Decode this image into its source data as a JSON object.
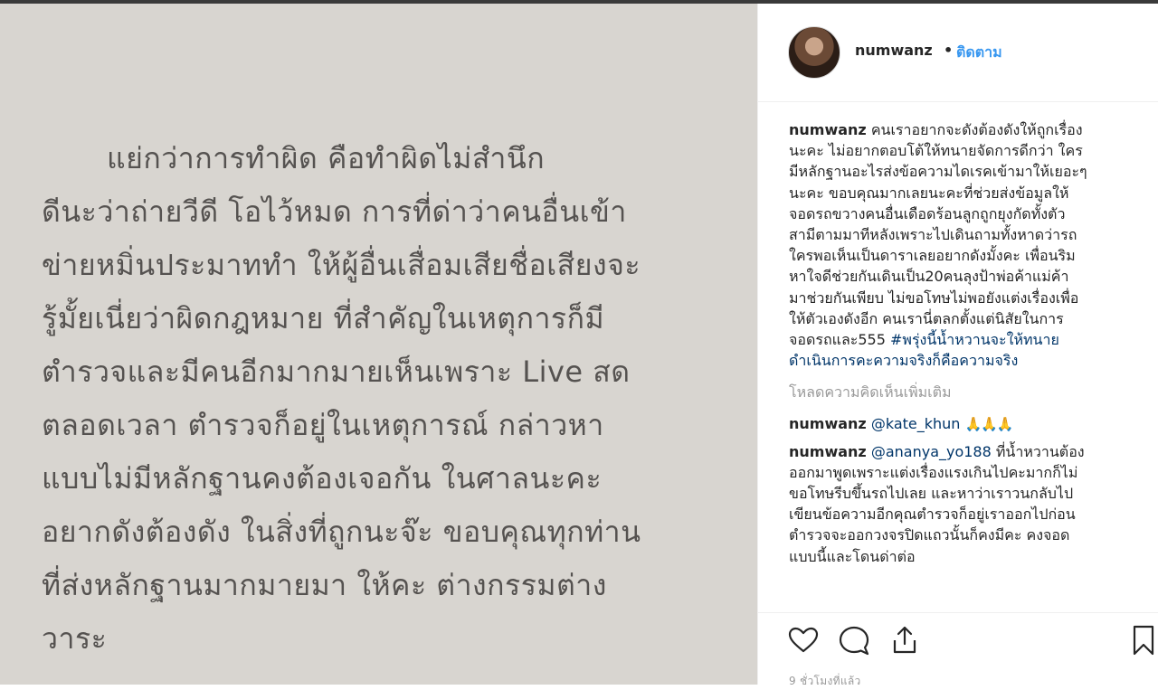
{
  "media": {
    "lines": [
      "แย่กว่าการทำผิด คือทำผิดไม่สำนึก",
      "ดีนะว่าถ่ายวีดี โอไว้หมด การที่ด่าว่าคนอื่นเข้า",
      "ข่ายหมิ่นประมาททำ ให้ผู้อื่นเสื่อมเสียชื่อเสียงจะ",
      "รู้มั้ยเนี่ยว่าผิดกฎหมาย ที่สำคัญในเหตุการก็มี",
      "ตำรวจและมีคนอีกมากมายเห็นเพราะ Live สด",
      "ตลอดเวลา ตำรวจก็อยู่ในเหตุการณ์ กล่าวหา",
      "แบบไม่มีหลักฐานคงต้องเจอกัน ในศาลนะคะ",
      "อยากดังต้องดัง ในสิ่งที่ถูกนะจ๊ะ ขอบคุณทุกท่าน",
      "ที่ส่งหลักฐานมากมายมา ให้คะ ต่างกรรมต่าง",
      "วาระ"
    ]
  },
  "header": {
    "username": "numwanz",
    "separator": "•",
    "follow_label": "ติดตาม"
  },
  "caption": {
    "username": "numwanz",
    "lines": [
      " คนเราอยากจะดังต้องดังให้ถูกเรื่อง",
      "นะคะ ไม่อยากตอบโต้ให้ทนายจัดการดีกว่า ใคร",
      "มีหลักฐานอะไรส่งข้อความไดเรคเข้ามาให้เยอะๆ",
      "นะคะ ขอบคุณมากเลยนะคะที่ช่วยส่งข้อมูลให้",
      "จอดรถขวางคนอื่นเดือดร้อนลูกถูกยุงกัดทั้งตัว",
      "สามีตามมาทีหลังเพราะไปเดินถามทั้งหาดว่ารถ",
      "ใครพอเห็นเป็นดาราเลยอยากดังมั้งคะ เพื่อนริม",
      "หาใจดีช่วยกันเดินเป็น20คนลุงป้าพ่อค้าแม่ค้า",
      "มาช่วยกันเพียบ ไม่ขอโทษไม่พอยังแต่งเรื่องเพื่อ",
      "ให้ตัวเองดังอีก คนเรานี่ตลกตั้งแต่นิสัยในการ",
      "จอดรถและ555 "
    ],
    "hashtag_part1": "#พรุ่งนี้น้ำหวานจะให้ทนาย",
    "hashtag_part2": "ดำเนินการคะความจริงก็คือความจริง"
  },
  "load_more_label": "โหลดความคิดเห็นเพิ่มเติม",
  "comments": [
    {
      "username": "numwanz",
      "mention": "@kate_khun",
      "emoji": "🙏🙏🙏"
    },
    {
      "username": "numwanz",
      "mention": "@ananya_yo188",
      "first_rest": " ที่น้ำหวานต้อง",
      "lines": [
        "ออกมาพูดเพราะแต่งเรื่องแรงเกินไปคะมากก็ไม่",
        "ขอโทษรีบขึ้นรถไปเลย และหาว่าเราวนกลับไป",
        "เขียนข้อความอีกคุณตำรวจก็อยู่เราออกไปก่อน",
        "ตำรวจจะออกวงจรปิดแถวนั้นก็คงมีคะ คงจอด",
        "แบบนี้และโดนด่าต่อ"
      ]
    }
  ],
  "actions": {
    "like_icon": "heart-icon",
    "comment_icon": "comment-icon",
    "share_icon": "share-icon",
    "save_icon": "bookmark-icon"
  },
  "timestamp": "9 ชั่วโมงที่แล้ว"
}
